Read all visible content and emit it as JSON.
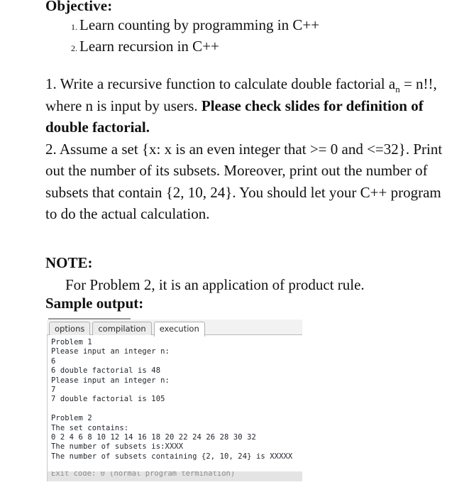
{
  "document": {
    "objective": {
      "heading": "Objective:",
      "items": [
        {
          "number": "1.",
          "text": "Learn counting by programming in C++"
        },
        {
          "number": "2.",
          "text": "Learn recursion in C++"
        }
      ]
    },
    "problems": {
      "problem1": {
        "lead": "1. Write a recursive function to calculate double factorial a",
        "subscript": "n",
        "mid": " = n!!, where n is input by users. ",
        "emphasis": "Please check slides for definition of double factorial."
      },
      "problem2": {
        "text": "2. Assume a set {x: x is an even integer that >= 0 and <=32}. Print out the number of its subsets. Moreover, print out the number of subsets that contain {2, 10, 24}. You should let your C++ program to do the actual calculation."
      }
    },
    "note": {
      "heading": "NOTE:",
      "body": "For Problem 2, it is an application of product rule."
    },
    "sample_output_heading": "Sample output:"
  },
  "console": {
    "tabs": [
      {
        "label": "options",
        "active": false
      },
      {
        "label": "compilation",
        "active": false
      },
      {
        "label": "execution",
        "active": true
      }
    ],
    "lines": [
      "Problem 1",
      "Please input an integer n:",
      "6",
      "6 double factorial is 48",
      "Please input an integer n:",
      "7",
      "7 double factorial is 105",
      "",
      "Problem 2",
      "The set contains:",
      "0 2 4 6 8 10 12 14 16 18 20 22 24 26 28 30 32",
      "The number of subsets is:XXXX",
      "The number of subsets containing {2, 10, 24} is XXXXX"
    ],
    "exit_line": "Exit code: 0 (normal program termination)"
  },
  "colors": {
    "text": "#111111",
    "console_text": "#20242e",
    "tab_border": "#b0b0b0",
    "tab_active_bg": "#ffffff",
    "tab_inactive_bg": "#ececec",
    "exit_strip_bg": "#e4e4e4",
    "underline": "#9a9a9a"
  }
}
